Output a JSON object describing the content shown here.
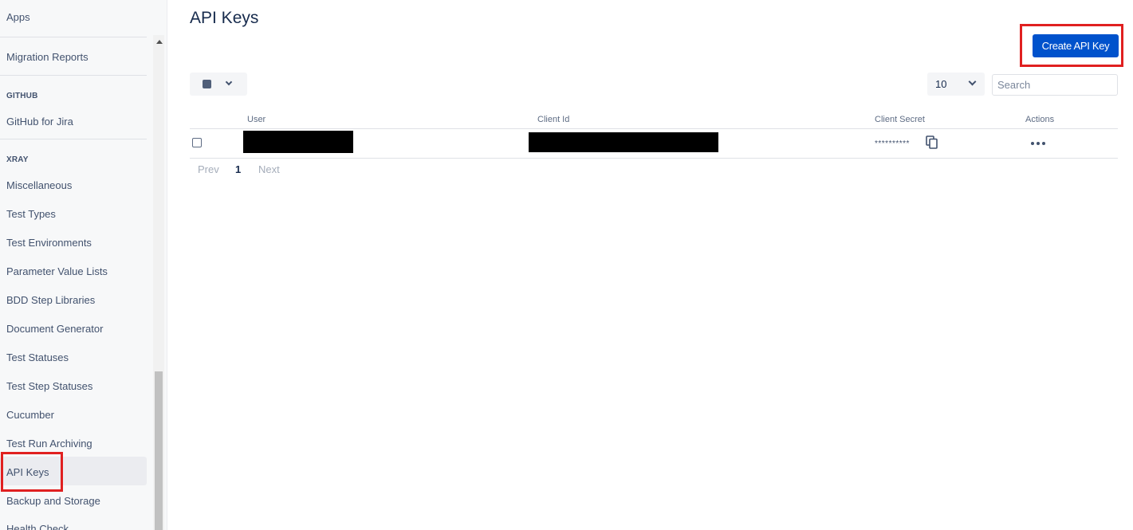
{
  "sidebar": {
    "top_item": "Apps",
    "migration_item": "Migration Reports",
    "github_heading": "GITHUB",
    "github_item": "GitHub for Jira",
    "xray_heading": "XRAY",
    "xray_items": [
      "Miscellaneous",
      "Test Types",
      "Test Environments",
      "Parameter Value Lists",
      "BDD Step Libraries",
      "Document Generator",
      "Test Statuses",
      "Test Step Statuses",
      "Cucumber",
      "Test Run Archiving",
      "API Keys",
      "Backup and Storage",
      "Health Check"
    ],
    "selected_item": "API Keys"
  },
  "main": {
    "title": "API Keys",
    "create_button": "Create API Key",
    "page_size": "10",
    "search_placeholder": "Search",
    "table": {
      "headers": {
        "user": "User",
        "client_id": "Client Id",
        "client_secret": "Client Secret",
        "actions": "Actions"
      },
      "rows": [
        {
          "user": "[redacted]",
          "client_id": "[redacted]",
          "client_secret": "**********"
        }
      ]
    },
    "pagination": {
      "prev": "Prev",
      "current": "1",
      "next": "Next"
    }
  },
  "colors": {
    "primary": "#0052cc",
    "highlight": "#e02020",
    "text": "#172b4d"
  },
  "icons": {
    "copy": "copy-icon",
    "more": "more-actions-icon",
    "dropdown": "chevron-down-icon"
  }
}
